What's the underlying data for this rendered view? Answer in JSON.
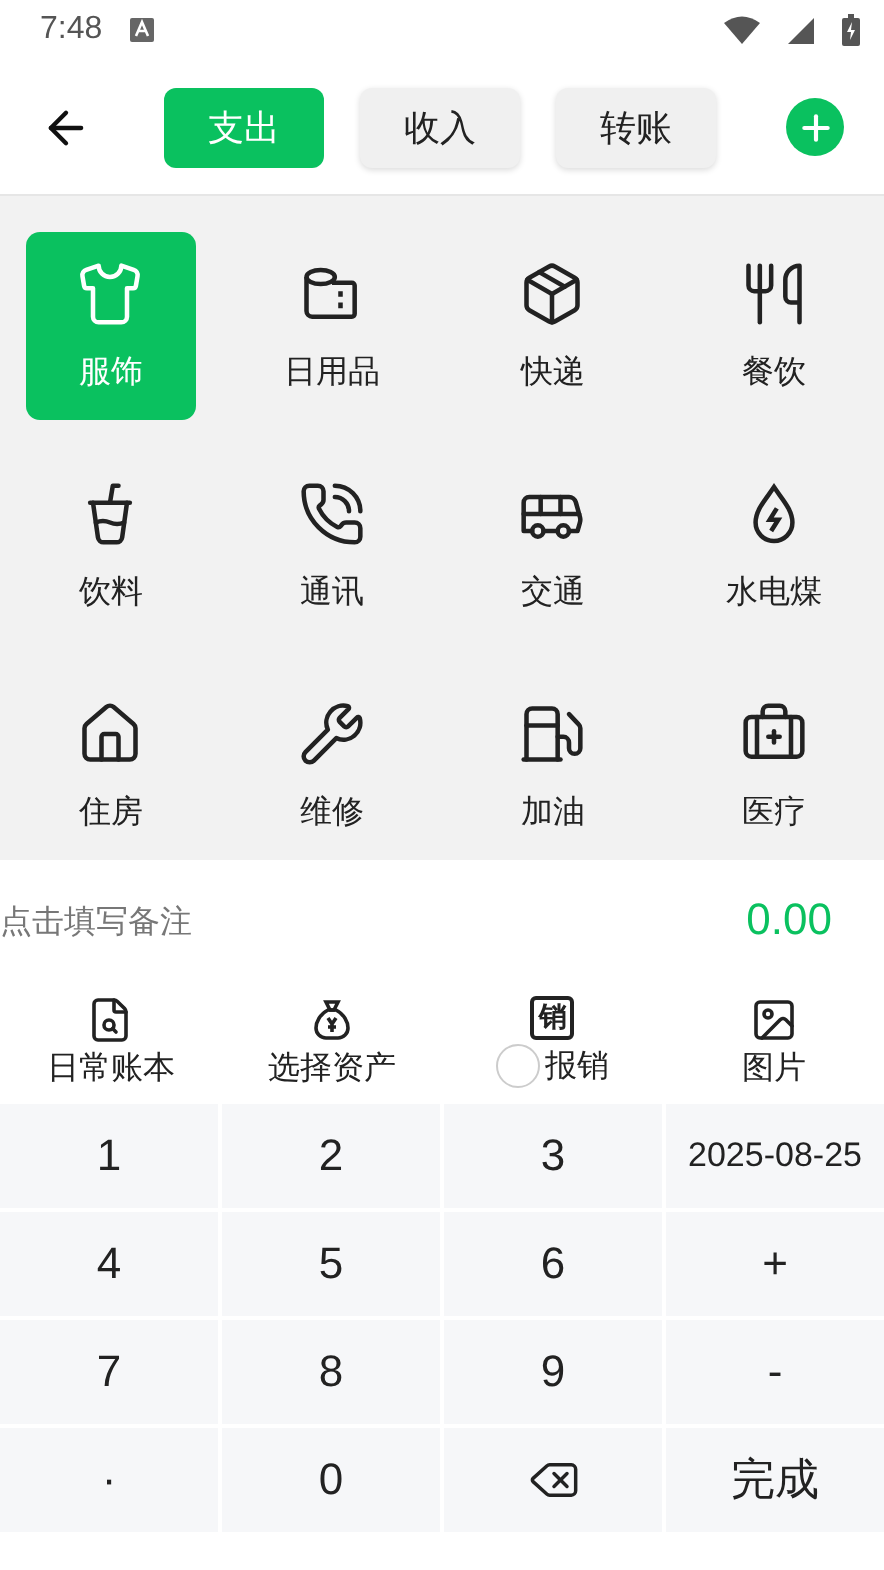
{
  "status_bar": {
    "time": "7:48"
  },
  "header": {
    "tabs": [
      {
        "label": "支出",
        "selected": true
      },
      {
        "label": "收入",
        "selected": false
      },
      {
        "label": "转账",
        "selected": false
      }
    ]
  },
  "categories": [
    {
      "kind": "shirt",
      "label": "服饰",
      "selected": true
    },
    {
      "kind": "roll",
      "label": "日用品",
      "selected": false
    },
    {
      "kind": "box",
      "label": "快递",
      "selected": false
    },
    {
      "kind": "cutlery",
      "label": "餐饮",
      "selected": false
    },
    {
      "kind": "cup",
      "label": "饮料",
      "selected": false
    },
    {
      "kind": "phone",
      "label": "通讯",
      "selected": false
    },
    {
      "kind": "bus",
      "label": "交通",
      "selected": false
    },
    {
      "kind": "drop",
      "label": "水电煤",
      "selected": false
    },
    {
      "kind": "house",
      "label": "住房",
      "selected": false
    },
    {
      "kind": "tools",
      "label": "维修",
      "selected": false
    },
    {
      "kind": "fuel",
      "label": "加油",
      "selected": false
    },
    {
      "kind": "medical",
      "label": "医疗",
      "selected": false
    }
  ],
  "note": {
    "placeholder": "点击填写备注",
    "amount": "0.00"
  },
  "tools": [
    {
      "kind": "book",
      "label": "日常账本"
    },
    {
      "kind": "moneybag",
      "label": "选择资产"
    },
    {
      "kind": "reimburse",
      "label": "报销",
      "badge": "销",
      "checked": false
    },
    {
      "kind": "image",
      "label": "图片"
    }
  ],
  "keypad": [
    {
      "kind": "text",
      "label": "1"
    },
    {
      "kind": "text",
      "label": "2"
    },
    {
      "kind": "text",
      "label": "3"
    },
    {
      "kind": "date",
      "label": "2025-08-25"
    },
    {
      "kind": "text",
      "label": "4"
    },
    {
      "kind": "text",
      "label": "5"
    },
    {
      "kind": "text",
      "label": "6"
    },
    {
      "kind": "text",
      "label": "+"
    },
    {
      "kind": "text",
      "label": "7"
    },
    {
      "kind": "text",
      "label": "8"
    },
    {
      "kind": "text",
      "label": "9"
    },
    {
      "kind": "text",
      "label": "-"
    },
    {
      "kind": "text",
      "label": "·"
    },
    {
      "kind": "text",
      "label": "0"
    },
    {
      "kind": "backspace"
    },
    {
      "kind": "done",
      "label": "完成"
    }
  ]
}
